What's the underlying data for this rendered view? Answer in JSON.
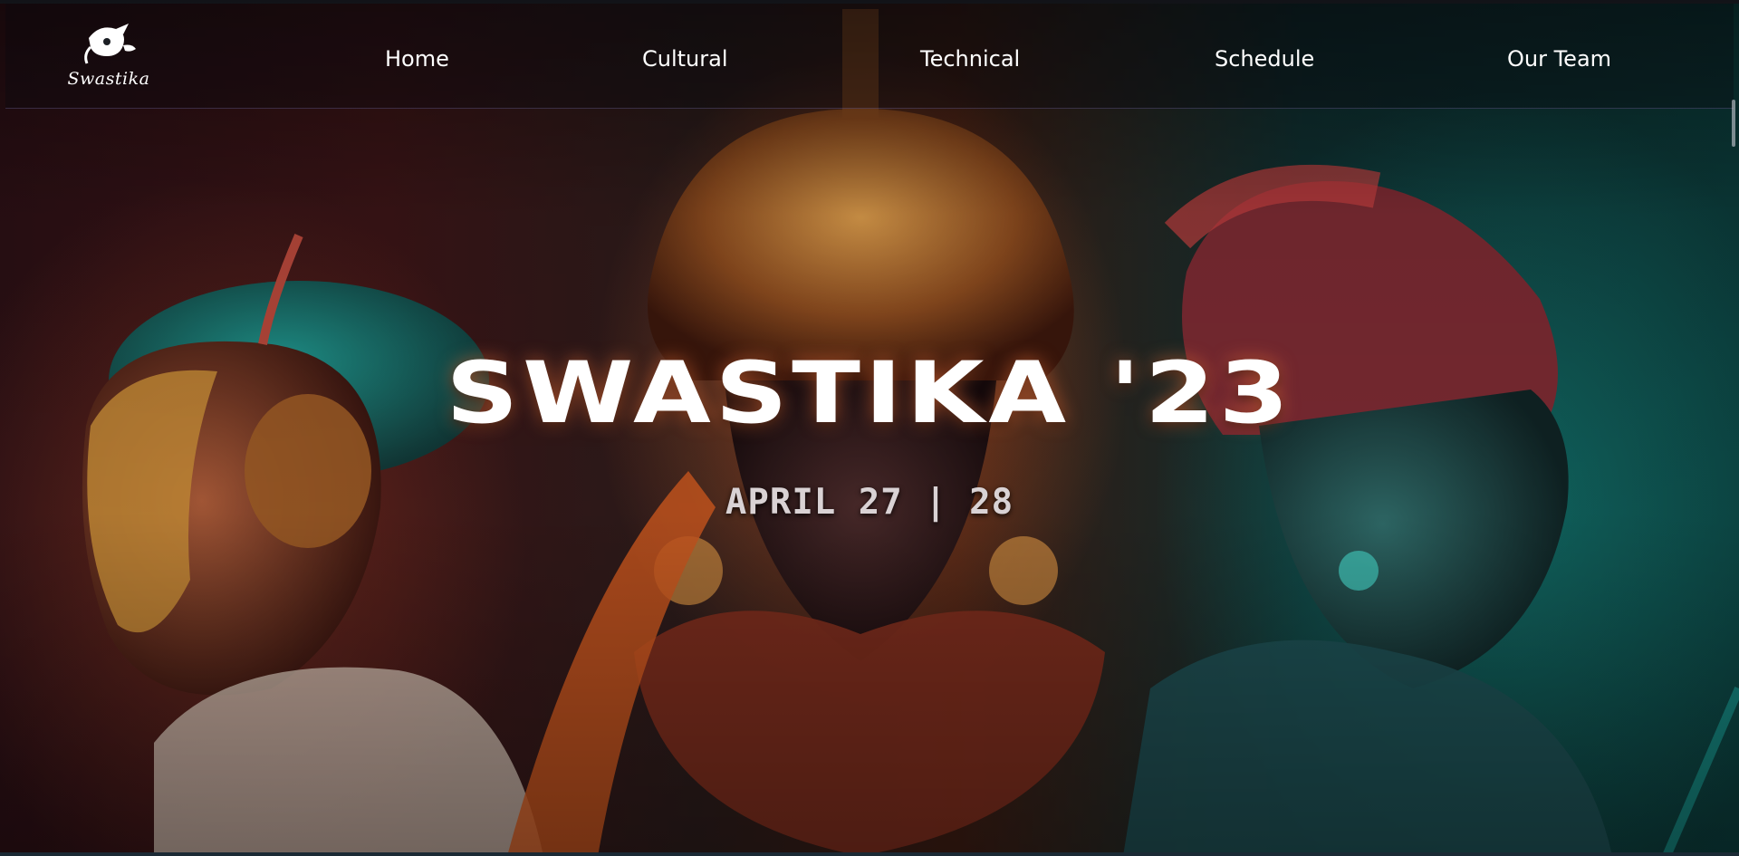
{
  "brand": {
    "logo_text": "Swastika",
    "logo_icon": "swastika-logo-icon"
  },
  "nav": {
    "items": [
      {
        "label": "Home"
      },
      {
        "label": "Cultural"
      },
      {
        "label": "Technical"
      },
      {
        "label": "Schedule"
      },
      {
        "label": "Our Team"
      }
    ]
  },
  "hero": {
    "title": "SWASTIKA '23",
    "date": "APRIL 27 | 28"
  },
  "colors": {
    "text": "#ffffff",
    "date_text": "#d9d2d4",
    "accent_warm": "#e86e32",
    "accent_teal": "#14968c"
  }
}
